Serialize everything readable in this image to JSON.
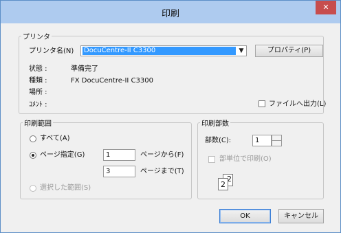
{
  "window": {
    "title": "印刷",
    "close_glyph": "✕"
  },
  "printer": {
    "legend": "プリンタ",
    "name_label": "プリンタ名(N)",
    "selected": "DocuCentre-II C3300",
    "properties_button": "プロパティ(P)",
    "status_label": "状態 :",
    "status_value": "準備完了",
    "type_label": "種類 :",
    "type_value": "FX DocuCentre-II C3300",
    "location_label": "場所 :",
    "comment_label": "ｺﾒﾝﾄ :",
    "print_to_file": "ファイルへ出力(L)"
  },
  "range": {
    "legend": "印刷範囲",
    "all": "すべて(A)",
    "pages": "ページ指定(G)",
    "from_value": "1",
    "from_suffix": "ページから(F)",
    "to_value": "3",
    "to_suffix": "ページまで(T)",
    "selection": "選択した範囲(S)"
  },
  "copies": {
    "legend": "印刷部数",
    "count_label": "部数(C):",
    "count_value": "1",
    "collate": "部単位で印刷(O)",
    "icon_page_back": "2",
    "icon_page_front": "2"
  },
  "buttons": {
    "ok": "OK",
    "cancel": "キャンセル"
  }
}
